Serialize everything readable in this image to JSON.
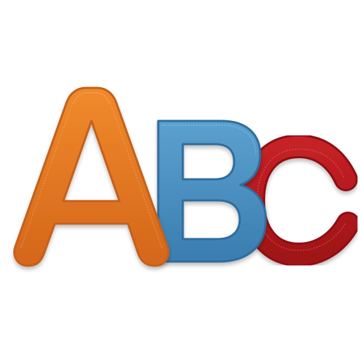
{
  "logo": {
    "text": "ABC",
    "letters": [
      {
        "char": "A",
        "color": "#e5781f"
      },
      {
        "char": "B",
        "color": "#4a8fbf"
      },
      {
        "char": "c",
        "color": "#b0181c"
      }
    ]
  }
}
